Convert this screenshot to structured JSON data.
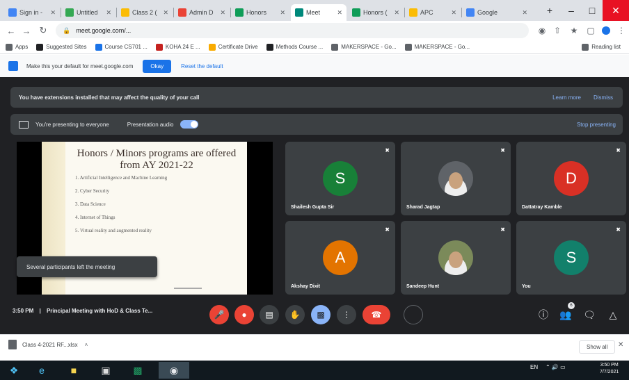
{
  "browser": {
    "tabs": [
      {
        "label": "Sign in -",
        "color": "#4285f4"
      },
      {
        "label": "Untitled",
        "color": "#34a853"
      },
      {
        "label": "Class 2 (",
        "color": "#fbbc04"
      },
      {
        "label": "Admin D",
        "color": "#ea4335"
      },
      {
        "label": "Honors",
        "color": "#0f9d58"
      },
      {
        "label": "Meet",
        "color": "#00897b"
      },
      {
        "label": "Honors (",
        "color": "#0f9d58"
      },
      {
        "label": "APC",
        "color": "#fbbc04"
      },
      {
        "label": "Google",
        "color": "#4285f4"
      }
    ],
    "url": "meet.google.com/...",
    "bookmarks": [
      {
        "label": "Apps",
        "color": "#5f6368"
      },
      {
        "label": "Suggested Sites",
        "color": "#202124"
      },
      {
        "label": "Course CS701 ...",
        "color": "#1a73e8"
      },
      {
        "label": "KOHA 24 E ...",
        "color": "#c5221f"
      },
      {
        "label": "Certificate Drive",
        "color": "#f9ab00"
      },
      {
        "label": "Methods Course ...",
        "color": "#202124"
      },
      {
        "label": "MAKERSPACE - Go...",
        "color": "#5f6368"
      },
      {
        "label": "MAKERSPACE - Go...",
        "color": "#5f6368"
      },
      {
        "label": "Reading list",
        "color": "#5f6368"
      }
    ]
  },
  "infobar": {
    "message": "Make this your default for meet.google.com",
    "button": "Okay",
    "link": "Reset the default"
  },
  "meet": {
    "ext_warning": "You have extensions installed that may affect the quality of your call",
    "learn_more": "Learn more",
    "dismiss": "Dismiss",
    "presenting": "You're presenting to everyone",
    "presentation_audio": "Presentation audio",
    "stop_presenting": "Stop presenting",
    "toast": "Several participants left the meeting",
    "slide": {
      "title": "Honors / Minors programs are offered from AY 2021-22",
      "bullets": [
        "1. Artificial Intelligence and Machine Learning",
        "2. Cyber Security",
        "3. Data Science",
        "4. Internet of Things",
        "5. Virtual reality and augmented reality"
      ]
    },
    "participants": [
      {
        "name": "Shailesh Gupta Sir",
        "initial": "S",
        "color": "#188038",
        "photo": false
      },
      {
        "name": "Sharad Jagtap",
        "initial": "",
        "color": "#5f6368",
        "photo": true
      },
      {
        "name": "Dattatray Kamble",
        "initial": "D",
        "color": "#d93025",
        "photo": false
      },
      {
        "name": "Akshay Dixit",
        "initial": "A",
        "color": "#e37400",
        "photo": false
      },
      {
        "name": "Sandeep Hunt",
        "initial": "",
        "color": "#7b8a5a",
        "photo": true
      },
      {
        "name": "You",
        "initial": "S",
        "color": "#12806b",
        "photo": false
      }
    ],
    "time": "3:50 PM",
    "separator": "|",
    "meeting_title": "Principal Meeting with HoD & Class Te...",
    "people_count": "6"
  },
  "downloads": {
    "file": "Class 4-2021 RF...xlsx",
    "show_all": "Show all"
  },
  "taskbar": {
    "lang": "EN",
    "time": "3:50 PM",
    "date": "7/7/2021"
  }
}
